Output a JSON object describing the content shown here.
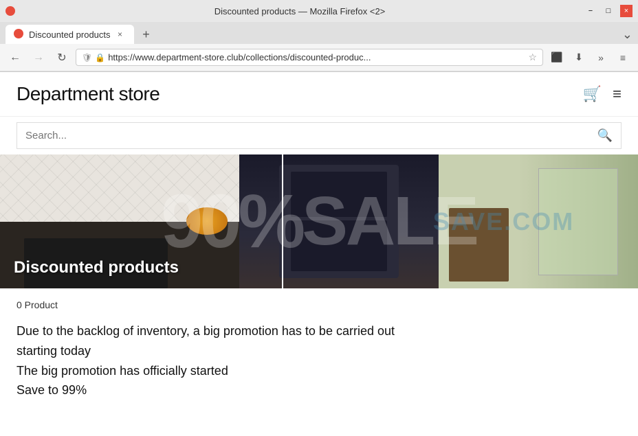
{
  "browser": {
    "title": "Discounted products — Mozilla Firefox <2>",
    "tab_label": "Discounted products",
    "url_display": "https://www.department-store.club/collections/discounted-produc...",
    "url_protocol_icon": "🔒",
    "url_shield": "🛡",
    "nav_back": "←",
    "nav_forward": "→",
    "nav_refresh": "↻",
    "tab_close": "×",
    "tab_new": "+",
    "tab_overflow": "⌄",
    "win_minimize": "−",
    "win_restore": "□",
    "win_close": "×",
    "bookmark_icon": "☆",
    "shield_icon": "🛡",
    "lock_icon": "🔒",
    "downloads_icon": "⬇",
    "extensions_icon": "»",
    "menu_icon": "≡"
  },
  "site": {
    "title": "Department store",
    "search_placeholder": "Search...",
    "cart_icon": "🛒",
    "menu_icon": "≡",
    "search_submit_icon": "🔍"
  },
  "hero": {
    "sale_big": "90%",
    "sale_word": "SALE",
    "title": "Discounted products",
    "watermark": "SAVE.COM"
  },
  "content": {
    "product_count": "0 Product",
    "promo_lines": [
      "Due to the backlog of inventory, a big promotion has to be carried out",
      "starting today",
      "The big promotion has officially started",
      "Save to 99%"
    ]
  }
}
